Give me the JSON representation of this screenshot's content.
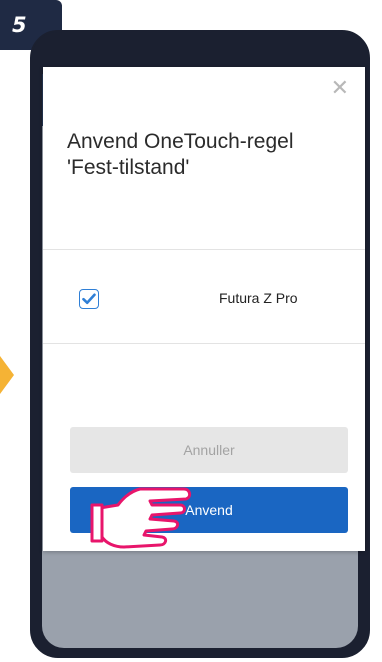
{
  "step": {
    "number": "5"
  },
  "dialog": {
    "title": "Anvend OneTouch-regel 'Fest-tilstand'",
    "close_icon": "close-icon",
    "devices": [
      {
        "label": "Futura Z Pro",
        "checked": true
      }
    ],
    "cancel_label": "Annuller",
    "apply_label": "Anvend"
  },
  "colors": {
    "badge": "#1f2a44",
    "phone_frame": "#1b2030",
    "topbar": "#243552",
    "apply_button": "#1a66c2",
    "cancel_button": "#e6e6e6",
    "hint_arrow": "#f5b335",
    "pointer_hand": "#e8156b"
  }
}
